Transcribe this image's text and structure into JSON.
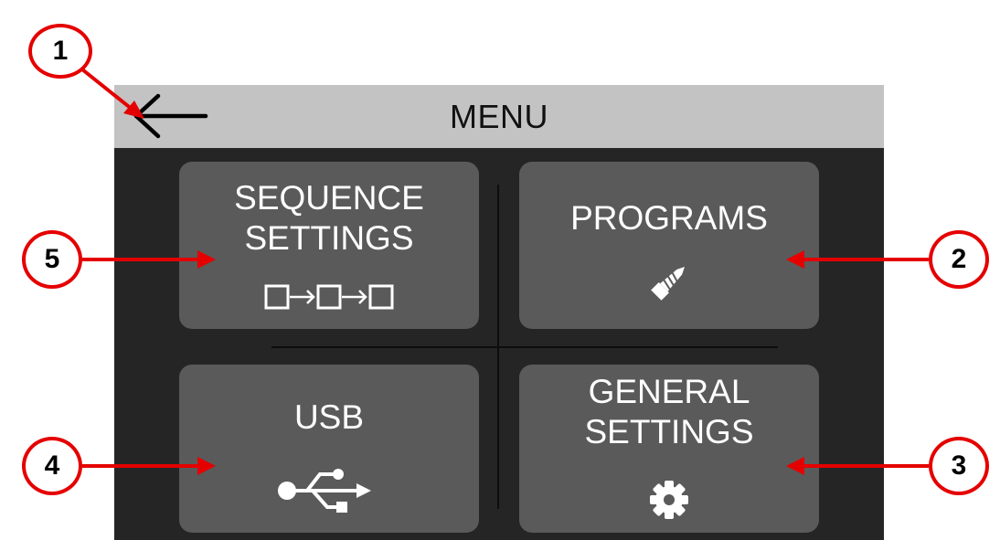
{
  "header": {
    "title": "MENU",
    "back_icon": "left-arrow-icon"
  },
  "tiles": [
    {
      "id": "sequence",
      "lines": [
        "SEQUENCE",
        "SETTINGS"
      ],
      "icon": "sequence-flow-icon"
    },
    {
      "id": "programs",
      "lines": [
        "PROGRAMS"
      ],
      "icon": "screw-icon"
    },
    {
      "id": "usb",
      "lines": [
        "USB"
      ],
      "icon": "usb-icon"
    },
    {
      "id": "general",
      "lines": [
        "GENERAL",
        "SETTINGS"
      ],
      "icon": "gear-icon"
    }
  ],
  "callouts": [
    "1",
    "2",
    "3",
    "4",
    "5"
  ],
  "colors": {
    "header_bg": "#c3c3c3",
    "screen_bg": "#252525",
    "tile_bg": "#5a5a5a",
    "callout_red": "#e50000"
  }
}
